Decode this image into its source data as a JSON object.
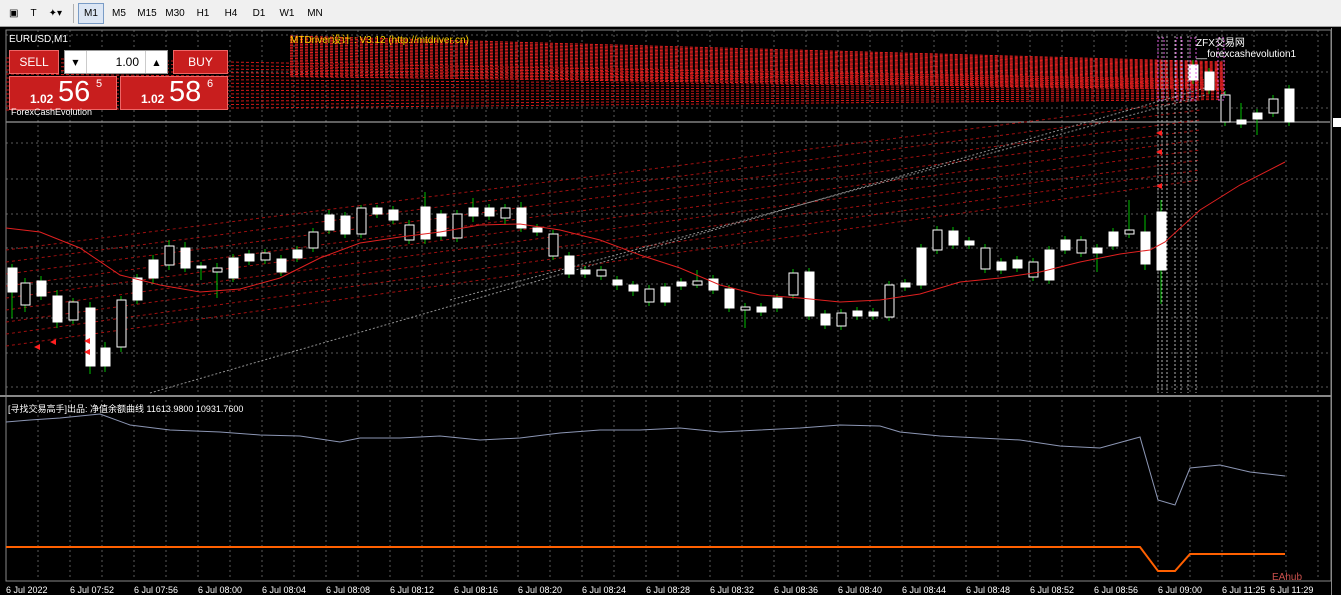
{
  "toolbar": {
    "timeframes": [
      "M1",
      "M5",
      "M15",
      "M30",
      "H1",
      "H4",
      "D1",
      "W1",
      "MN"
    ],
    "active": "M1"
  },
  "chart": {
    "symbol_label": "EURUSD,M1",
    "ea_title": "MTDriver设计 : V3.12 (http://mtdriver.cn)",
    "ea_name": "ZFX交易网 __forexcashevolution1",
    "indicator_label": "[寻找交易高手]出品: 净值余额曲线 11613.9800 10931.7600",
    "watermark": "EAhub",
    "colors": {
      "bull_candle": "#ffffff",
      "bear_candle": "#ffffff",
      "wick": "#00c000",
      "ma": "#e02020",
      "grid": "#5a5a5a",
      "equity": "#8c96b4",
      "balance": "#ff6000"
    }
  },
  "panel": {
    "sell_label": "SELL",
    "buy_label": "BUY",
    "lot": "1.00",
    "bid_small": "1.02",
    "bid_big": "56",
    "bid_sup": "5",
    "ask_small": "1.02",
    "ask_big": "58",
    "ask_sup": "6",
    "name": "ForexCashEvolution"
  },
  "time_axis": [
    "6 Jul 2022",
    "6 Jul 07:52",
    "6 Jul 07:56",
    "6 Jul 08:00",
    "6 Jul 08:04",
    "6 Jul 08:08",
    "6 Jul 08:12",
    "6 Jul 08:16",
    "6 Jul 08:20",
    "6 Jul 08:24",
    "6 Jul 08:28",
    "6 Jul 08:32",
    "6 Jul 08:36",
    "6 Jul 08:40",
    "6 Jul 08:44",
    "6 Jul 08:48",
    "6 Jul 08:52",
    "6 Jul 08:56",
    "6 Jul 09:00",
    "6 Jul 11:25",
    "6 Jul 11:29"
  ]
}
